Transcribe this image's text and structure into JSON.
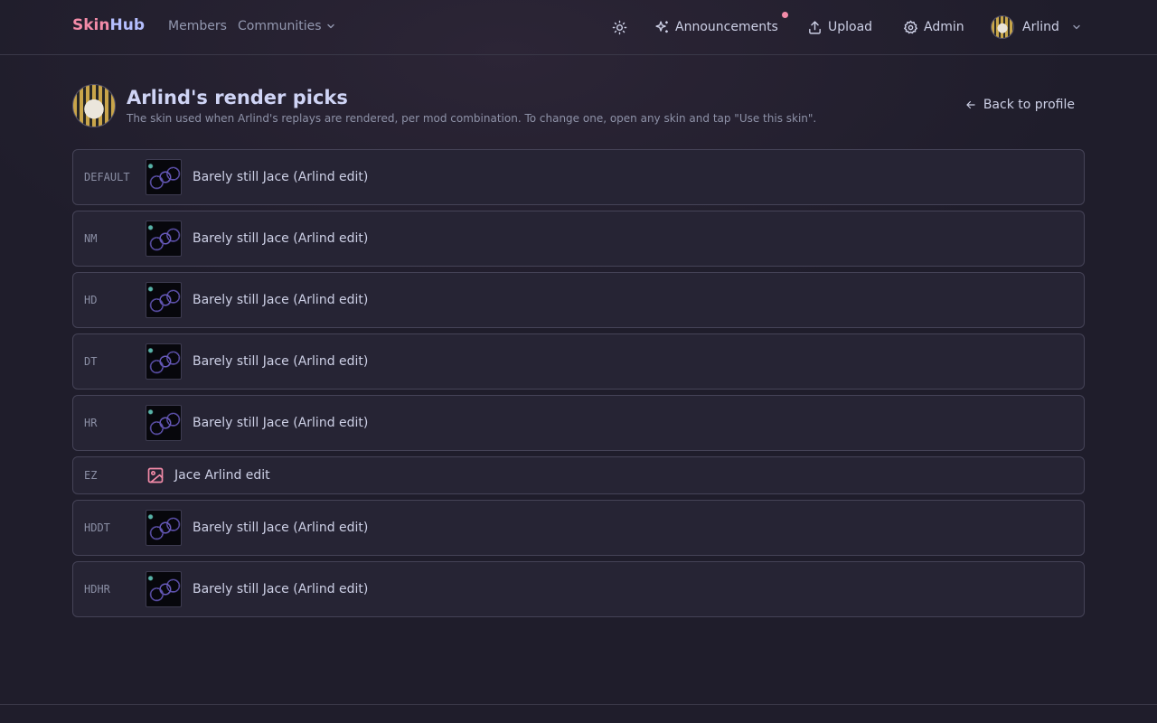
{
  "nav": {
    "brand_part1": "Skin",
    "brand_part2": "Hub",
    "members": "Members",
    "communities": "Communities",
    "announcements": "Announcements",
    "upload": "Upload",
    "admin": "Admin",
    "user": "Arlind",
    "notification_color": "#f38ba8"
  },
  "header": {
    "title": "Arlind's render picks",
    "subtitle": "The skin used when Arlind's replays are rendered, per mod combination. To change one, open any skin and tap \"Use this skin\".",
    "back": "Back to profile"
  },
  "picks": [
    {
      "mod": "DEFAULT",
      "skin": "Barely still Jace (Arlind edit)",
      "has_thumb": true
    },
    {
      "mod": "NM",
      "skin": "Barely still Jace (Arlind edit)",
      "has_thumb": true
    },
    {
      "mod": "HD",
      "skin": "Barely still Jace (Arlind edit)",
      "has_thumb": true
    },
    {
      "mod": "DT",
      "skin": "Barely still Jace (Arlind edit)",
      "has_thumb": true
    },
    {
      "mod": "HR",
      "skin": "Barely still Jace (Arlind edit)",
      "has_thumb": true
    },
    {
      "mod": "EZ",
      "skin": "Jace Arlind edit",
      "has_thumb": false,
      "icon": "image-icon"
    },
    {
      "mod": "HDDT",
      "skin": "Barely still Jace (Arlind edit)",
      "has_thumb": true
    },
    {
      "mod": "HDHR",
      "skin": "Barely still Jace (Arlind edit)",
      "has_thumb": true
    }
  ],
  "colors": {
    "accent_pink": "#f38ba8",
    "accent_lavender": "#b4befe",
    "background": "#1f1d2b",
    "card": "#262434"
  }
}
